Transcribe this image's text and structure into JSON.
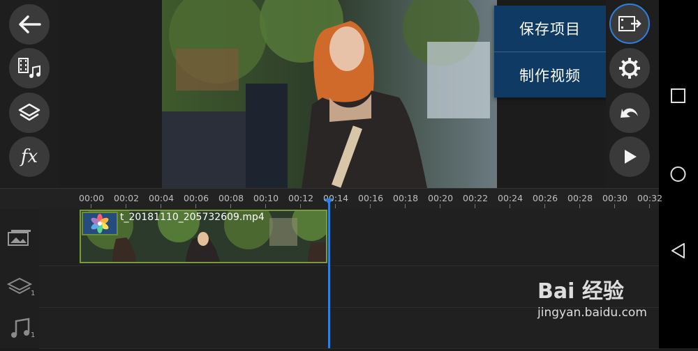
{
  "menu": {
    "items": [
      {
        "label": "保存项目"
      },
      {
        "label": "制作视频"
      }
    ]
  },
  "left_toolbar": {
    "fx_label": "fx"
  },
  "timeline": {
    "ticks": [
      "00:00",
      "00:02",
      "00:04",
      "00:06",
      "00:08",
      "00:10",
      "00:12",
      "00:14",
      "00:16",
      "00:18",
      "00:20",
      "00:22",
      "00:24",
      "00:26",
      "00:28",
      "00:30",
      "00:32"
    ],
    "clip_name": "t_20181110_205732609.mp4",
    "layer_count": "1",
    "audio_count": "1"
  },
  "watermark": {
    "logo": "Bai  经验",
    "url": "jingyan.baidu.com"
  },
  "colors": {
    "menu_bg": "#0f3a63",
    "playhead": "#2e7fe0",
    "clip_border": "#7a9b3a"
  }
}
